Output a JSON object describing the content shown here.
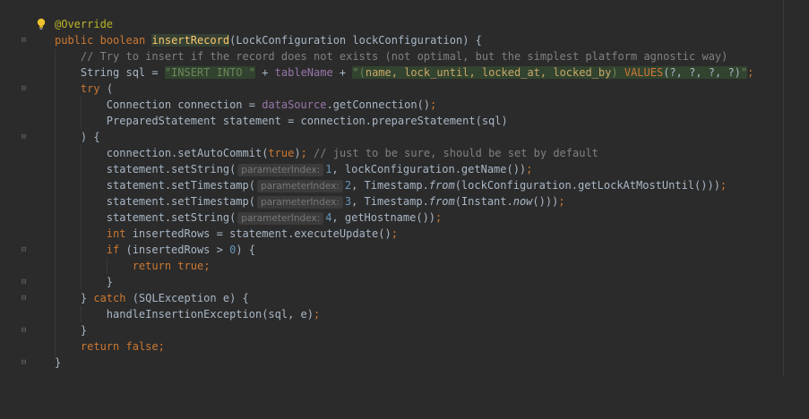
{
  "editor": {
    "language": "java",
    "colors": {
      "background": "#2b2b2b",
      "keyword": "#cc7832",
      "annotation": "#bbb529",
      "method": "#ffc66d",
      "string": "#6a8759",
      "number": "#6897bb",
      "comment": "#808080",
      "field": "#9876aa",
      "text": "#a9b7c6"
    },
    "icons": {
      "gutter_intention": "lightbulb-icon",
      "fold_markers": "fold-marker-icon"
    }
  },
  "code": {
    "l01": {
      "annotation": "@Override"
    },
    "l02": {
      "kw1": "public",
      "kw2": "boolean",
      "method": "insertRecord",
      "rest": "(LockConfiguration lockConfiguration) {"
    },
    "l03": {
      "comment": "// Try to insert if the record does not exists (not optimal, but the simplest platform agnostic way)"
    },
    "l04": {
      "a": "String sql = ",
      "s1": "\"INSERT INTO \"",
      "b": " + ",
      "field": "tableName",
      "c": " + ",
      "s2a": "\"(",
      "s2b": "name, lock_until, locked_at, locked_by",
      "s2c": ") ",
      "s2d": "VALUES",
      "s2e": "(?, ?, ?, ?)",
      "s2f": "\"",
      "end": ";"
    },
    "l05": {
      "kw": "try",
      "rest": " ("
    },
    "l06": {
      "a": "Connection connection = ",
      "field": "dataSource",
      "b": ".getConnection()",
      "end": ";"
    },
    "l07": {
      "a": "PreparedStatement statement = connection.prepareStatement(sql)"
    },
    "l08": {
      "a": ") {"
    },
    "l09": {
      "a": "connection.setAutoCommit(",
      "kw": "true",
      "b": ")",
      "semi": ";",
      "comment": " // just to be sure, should be set by default"
    },
    "l10": {
      "a": "statement.setString(",
      "hint": "parameterIndex:",
      "num": "1",
      "b": ", lockConfiguration.getName())",
      "end": ";"
    },
    "l11": {
      "a": "statement.setTimestamp(",
      "hint": "parameterIndex:",
      "num": "2",
      "b": ", Timestamp.",
      "it": "from",
      "c": "(lockConfiguration.getLockAtMostUntil()))",
      "end": ";"
    },
    "l12": {
      "a": "statement.setTimestamp(",
      "hint": "parameterIndex:",
      "num": "3",
      "b": ", Timestamp.",
      "it1": "from",
      "c": "(Instant.",
      "it2": "now",
      "d": "()))",
      "end": ";"
    },
    "l13": {
      "a": "statement.setString(",
      "hint": "parameterIndex:",
      "num": "4",
      "b": ", getHostname())",
      "end": ";"
    },
    "l14": {
      "kw": "int",
      "a": " insertedRows = statement.executeUpdate()",
      "end": ";"
    },
    "l15": {
      "kw": "if",
      "a": " (insertedRows > ",
      "num": "0",
      "b": ") {"
    },
    "l16": {
      "kw1": "return",
      "kw2": "true",
      "end": ";"
    },
    "l17": {
      "a": "}"
    },
    "l18": {
      "a": "} ",
      "kw": "catch",
      "b": " (SQLException e) {"
    },
    "l19": {
      "a": "handleInsertionException(sql, e)",
      "end": ";"
    },
    "l20": {
      "a": "}"
    },
    "l21": {
      "kw1": "return",
      "kw2": "false",
      "end": ";"
    },
    "l22": {
      "a": "}"
    }
  }
}
